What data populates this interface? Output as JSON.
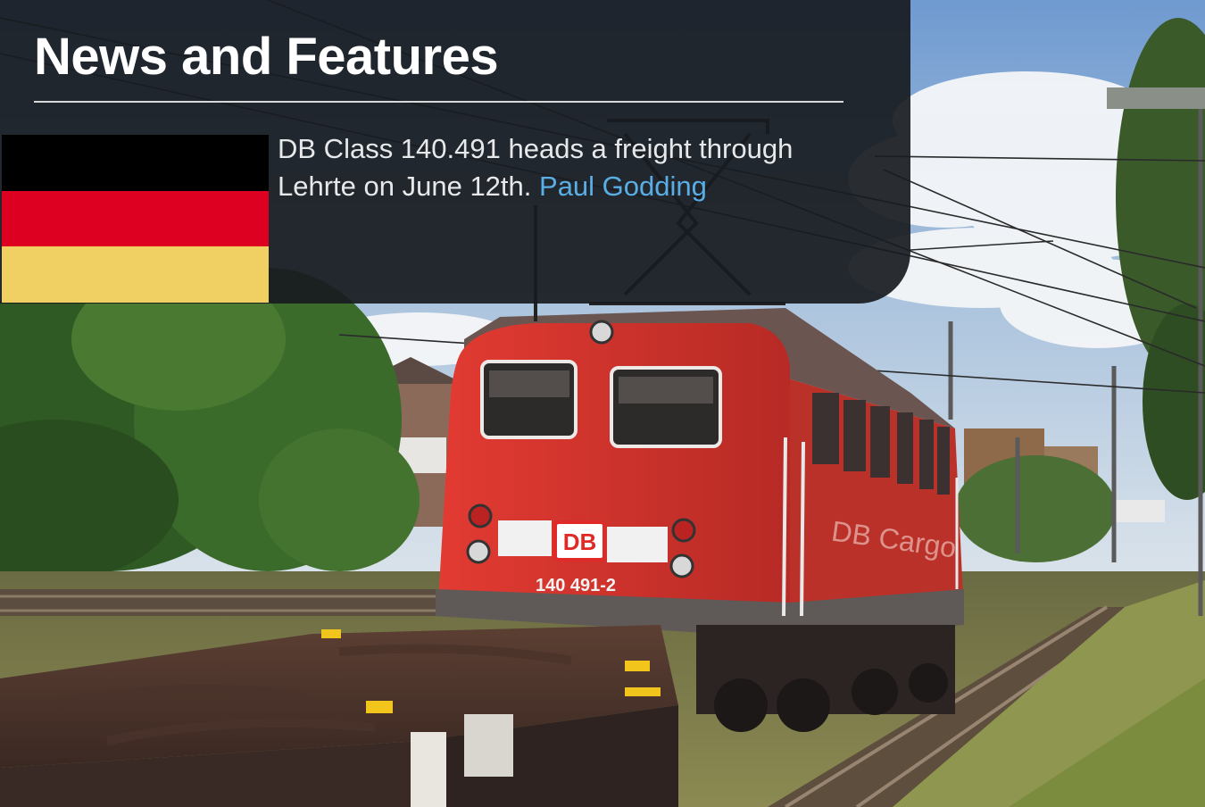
{
  "header": {
    "title": "News and Features"
  },
  "feature": {
    "caption_text": "DB Class 140.491 heads a freight through Lehrte on June 12th.",
    "credit_link": "Paul Godding",
    "flag": {
      "icon": "germany-flag-icon",
      "colors": [
        "#000000",
        "#dd0020",
        "#f0cf63"
      ]
    }
  },
  "photo": {
    "locomotive_logo": "DB",
    "locomotive_number": "140 491-2",
    "side_branding": "DB Cargo"
  },
  "colors": {
    "overlay": "#181b20",
    "link": "#5aaee6",
    "locomotive_red": "#d8342d"
  }
}
